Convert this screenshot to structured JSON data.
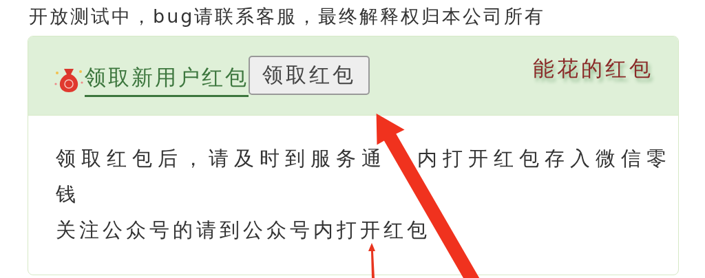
{
  "notice": "开放测试中，bug请联系客服，最终解释权归本公司所有",
  "panel": {
    "link": "领取新用户红包",
    "button": "领取红包",
    "title": "能花的红包",
    "lines": [
      [
        "领取红包后，请及时到服务通",
        "内打开红包存入微信零"
      ],
      [
        "钱"
      ],
      [
        "关注公众号的请到公众号内打开红包"
      ]
    ]
  }
}
